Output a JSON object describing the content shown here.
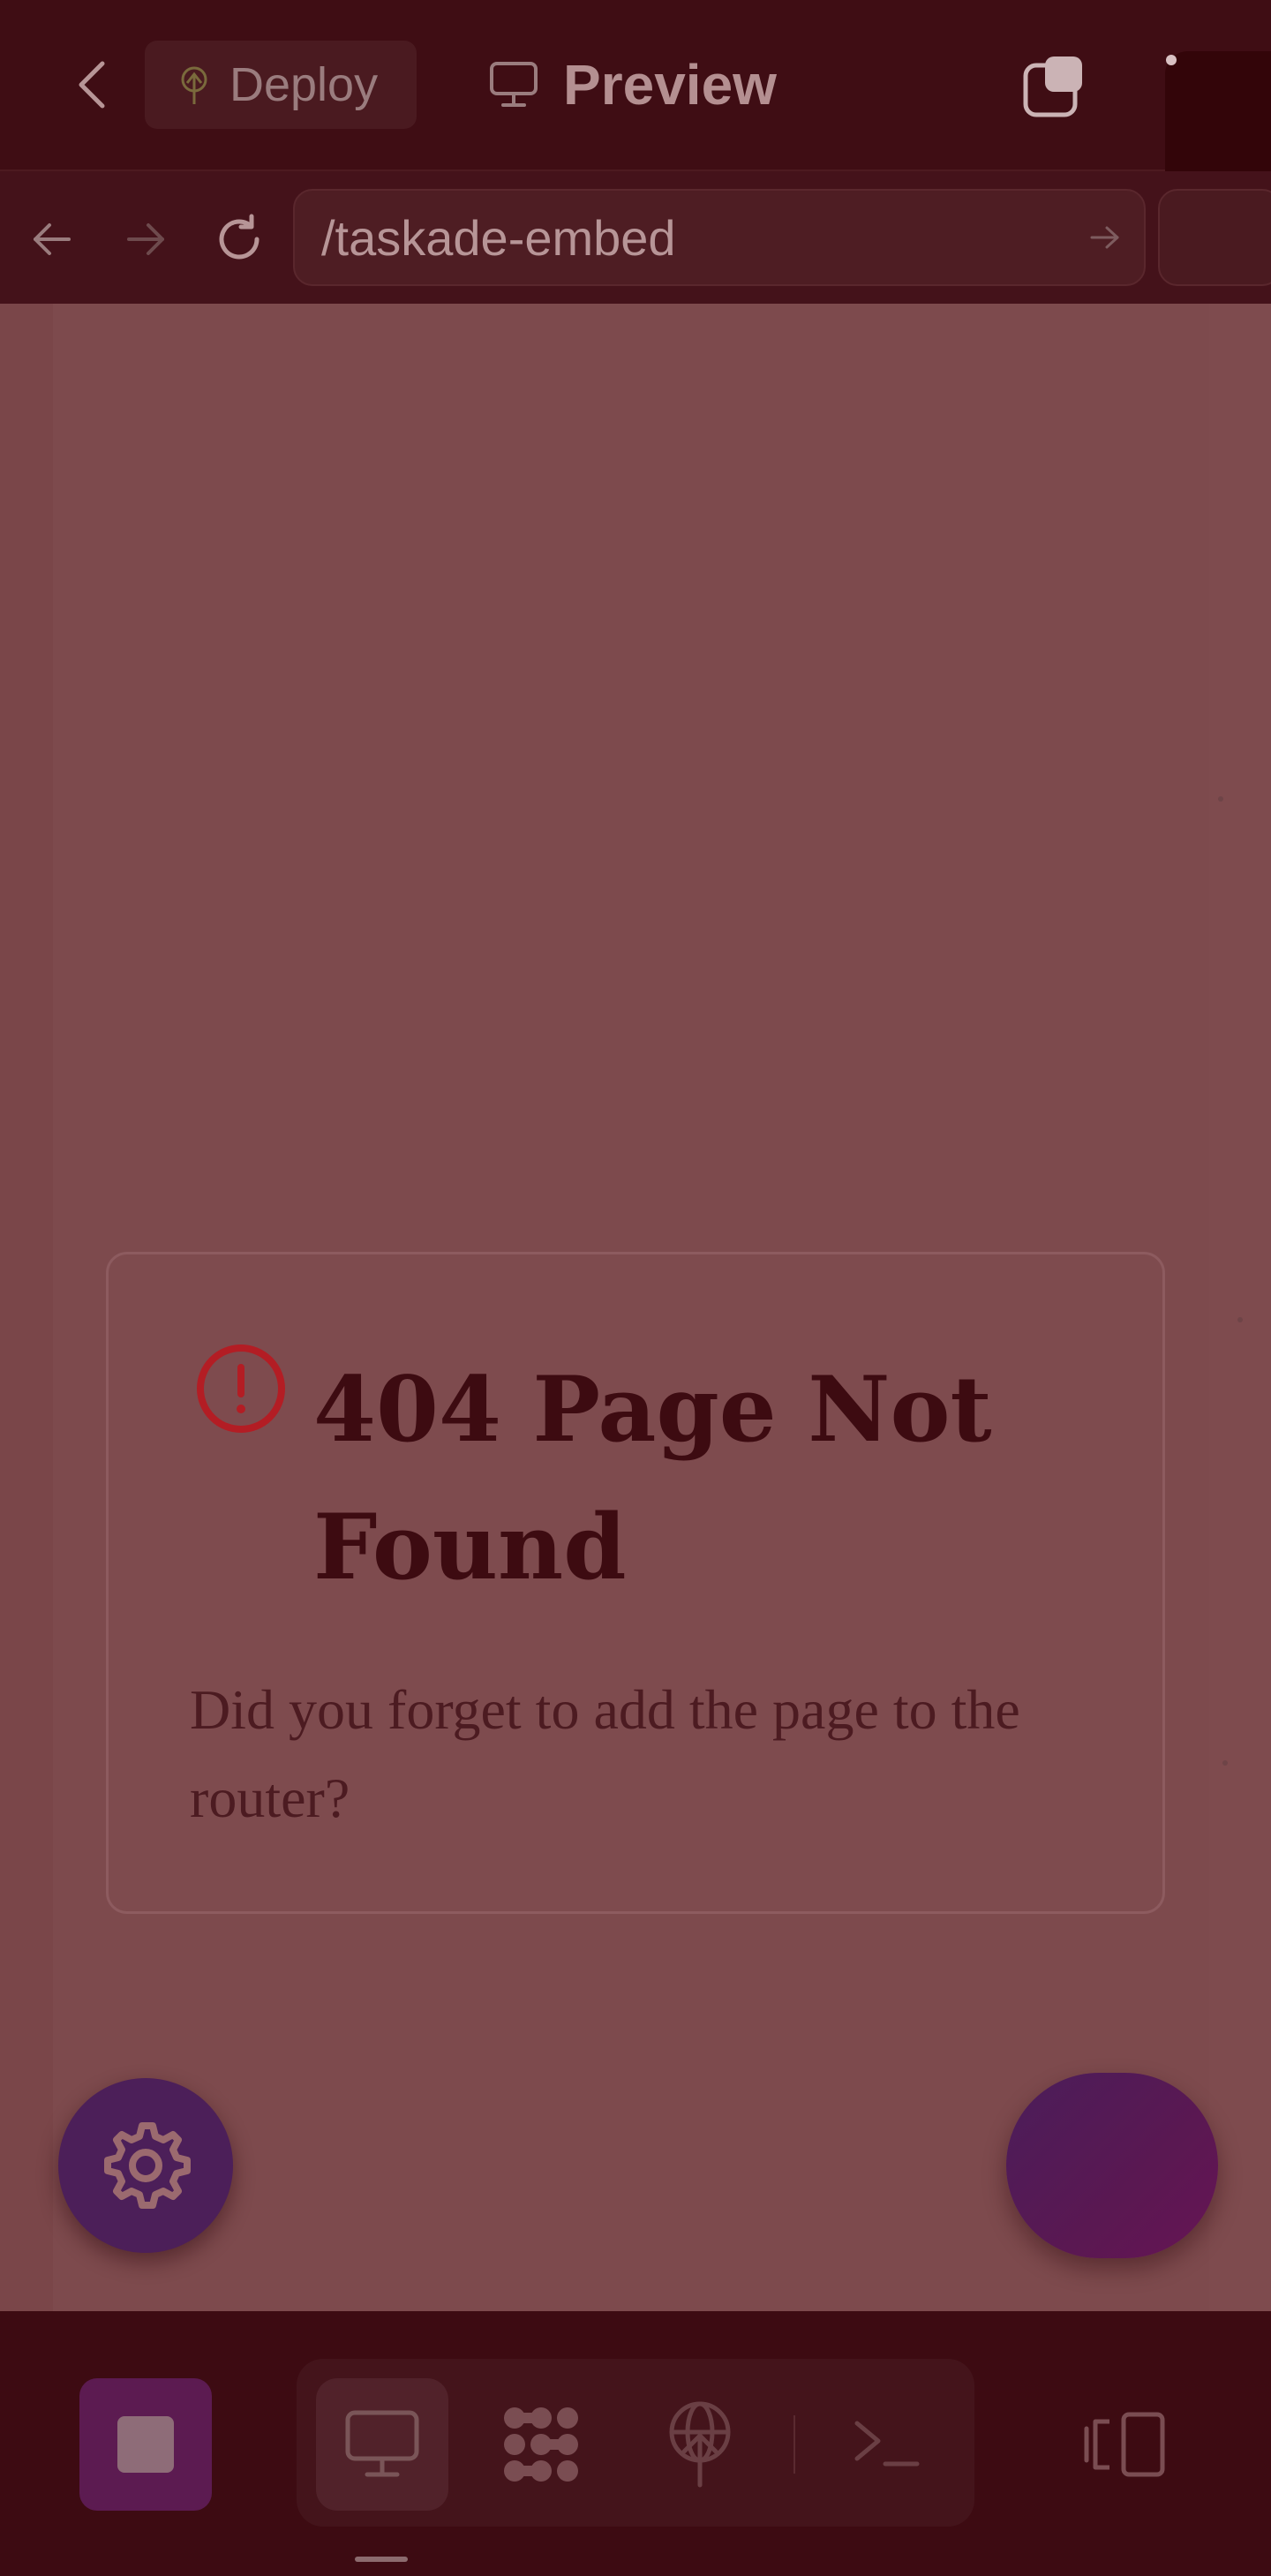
{
  "header": {
    "deploy_label": "Deploy",
    "preview_label": "Preview",
    "icons": {
      "back": "chevron-left-icon",
      "deploy": "rocket-globe-icon",
      "preview": "monitor-icon",
      "copy": "copy-stack-icon"
    }
  },
  "urlbar": {
    "path": "/taskade-embed",
    "icons": [
      "arrow-left-icon",
      "arrow-right-icon",
      "reload-icon",
      "go-arrow-icon"
    ]
  },
  "error_page": {
    "title": "404 Page Not Found",
    "message": "Did you forget to add the page to the router?",
    "icon": "alert-circle-icon",
    "accent_color": "#b31d24"
  },
  "floating": {
    "settings_icon": "gear-icon",
    "settings_color": "#4c1f59",
    "chat_color": "#5a1852"
  },
  "bottombar": {
    "stop_icon": "stop-square-icon",
    "tools": [
      "monitor-icon",
      "apps-grid-icon",
      "deploy-globe-icon",
      "terminal-icon"
    ],
    "right_icon": "panel-switch-icon",
    "accent_color": "#5c1b51"
  }
}
